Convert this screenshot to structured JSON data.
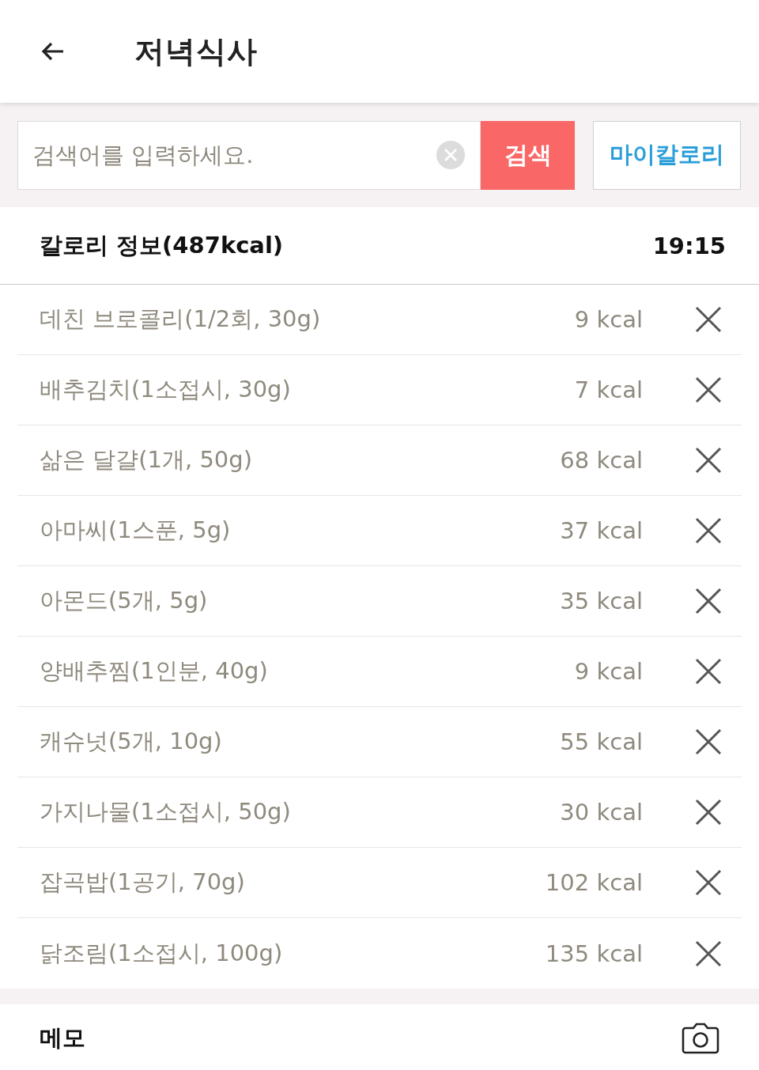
{
  "header": {
    "title": "저녁식사"
  },
  "search": {
    "placeholder": "검색어를 입력하세요.",
    "search_button": "검색",
    "my_calorie_button": "마이칼로리"
  },
  "calorie_info": {
    "title": "칼로리 정보(487kcal)",
    "time": "19:15"
  },
  "food_items": [
    {
      "name": "데친 브로콜리(1/2회, 30g)",
      "calories": "9 kcal"
    },
    {
      "name": "배추김치(1소접시, 30g)",
      "calories": "7 kcal"
    },
    {
      "name": "삶은 달걀(1개, 50g)",
      "calories": "68 kcal"
    },
    {
      "name": "아마씨(1스푼, 5g)",
      "calories": "37 kcal"
    },
    {
      "name": "아몬드(5개, 5g)",
      "calories": "35 kcal"
    },
    {
      "name": "양배추찜(1인분, 40g)",
      "calories": "9 kcal"
    },
    {
      "name": "캐슈넛(5개, 10g)",
      "calories": "55 kcal"
    },
    {
      "name": "가지나물(1소접시, 50g)",
      "calories": "30 kcal"
    },
    {
      "name": "잡곡밥(1공기, 70g)",
      "calories": "102 kcal"
    },
    {
      "name": "닭조림(1소접시, 100g)",
      "calories": "135 kcal"
    }
  ],
  "memo": {
    "label": "메모"
  }
}
